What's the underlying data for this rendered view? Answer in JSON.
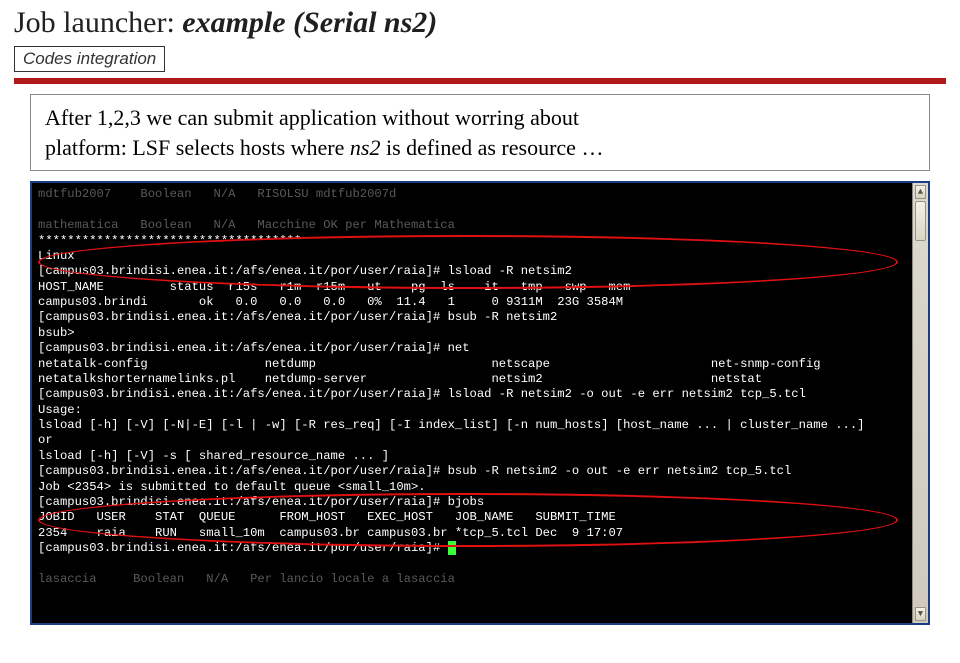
{
  "title": {
    "plain": "Job launcher: ",
    "emph": "example (Serial ns2)"
  },
  "subtitle": "Codes integration",
  "explain": {
    "line1_a": "After 1,2,3 we can submit application without worring about",
    "line2_a": "platform: LSF selects hosts where ",
    "line2_em": "ns2",
    "line2_b": " is defined as resource …"
  },
  "annotations": {
    "ellipse1_label": "lsload-highlight",
    "ellipse2_label": "bsub-highlight"
  },
  "terminal": {
    "lines": [
      "mdtfub2007    Boolean   N/A   RISOLSU mdtfub2007d                                             ",
      "                                                                                               ",
      "mathematica   Boolean   N/A   Macchine OK per Mathematica                                     ",
      "************************************",
      "Linux",
      "[campus03.brindisi.enea.it:/afs/enea.it/por/user/raia]# lsload -R netsim2",
      "HOST_NAME         status  r15s   r1m  r15m   ut    pg  ls    it   tmp   swp   mem",
      "campus03.brindi       ok   0.0   0.0   0.0   0%  11.4   1     0 9311M  23G 3584M",
      "[campus03.brindisi.enea.it:/afs/enea.it/por/user/raia]# bsub -R netsim2",
      "bsub>",
      "[campus03.brindisi.enea.it:/afs/enea.it/por/user/raia]# net",
      "netatalk-config                netdump                        netscape                      net-snmp-config",
      "netatalkshorternamelinks.pl    netdump-server                 netsim2                       netstat",
      "[campus03.brindisi.enea.it:/afs/enea.it/por/user/raia]# lsload -R netsim2 -o out -e err netsim2 tcp_5.tcl",
      "Usage:",
      "lsload [-h] [-V] [-N|-E] [-l | -w] [-R res_req] [-I index_list] [-n num_hosts] [host_name ... | cluster_name ...]",
      "or",
      "lsload [-h] [-V] -s [ shared_resource_name ... ]",
      "[campus03.brindisi.enea.it:/afs/enea.it/por/user/raia]# bsub -R netsim2 -o out -e err netsim2 tcp_5.tcl",
      "Job <2354> is submitted to default queue <small_10m>.",
      "[campus03.brindisi.enea.it:/afs/enea.it/por/user/raia]# bjobs",
      "JOBID   USER    STAT  QUEUE      FROM_HOST   EXEC_HOST   JOB_NAME   SUBMIT_TIME",
      "2354    raia    RUN   small_10m  campus03.br campus03.br *tcp_5.tcl Dec  9 17:07",
      "[campus03.brindisi.enea.it:/afs/enea.it/por/user/raia]# ",
      "                                                                                               ",
      "lasaccia     Boolean   N/A   Per lancio locale a lasaccia                                     "
    ],
    "cursor_after_line_index": 23
  }
}
